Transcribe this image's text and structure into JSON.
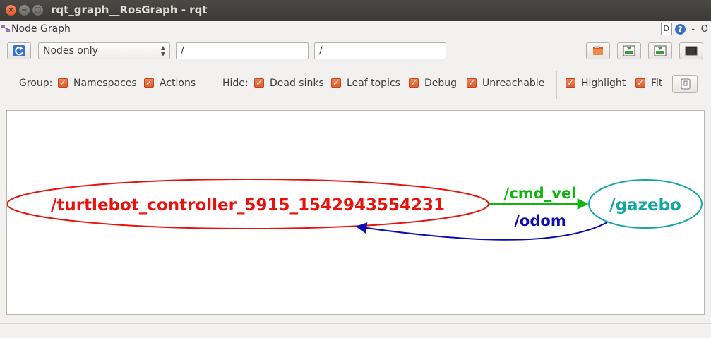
{
  "window": {
    "title": "rqt_graph__RosGraph - rqt"
  },
  "plugin": {
    "title": "Node Graph",
    "help_label": "D",
    "question": "?",
    "dash": "-",
    "circle": "O"
  },
  "toolbar": {
    "view_mode": "Nodes only",
    "filter_nodes": "/",
    "filter_topics": "/"
  },
  "options": {
    "group_label": "Group:",
    "namespaces": "Namespaces",
    "actions": "Actions",
    "hide_label": "Hide:",
    "dead_sinks": "Dead sinks",
    "leaf_topics": "Leaf topics",
    "debug": "Debug",
    "unreachable": "Unreachable",
    "highlight": "Highlight",
    "fit": "Fit",
    "checked": "✓"
  },
  "graph": {
    "nodes": [
      {
        "id": "controller",
        "label": "/turtlebot_controller_5915_1542943554231",
        "color": "#e8120c"
      },
      {
        "id": "gazebo",
        "label": "/gazebo",
        "color": "#14a6a2"
      }
    ],
    "edges": [
      {
        "label": "/cmd_vel",
        "color": "#10b510"
      },
      {
        "label": "/odom",
        "color": "#0c0cae"
      }
    ]
  },
  "colors": {
    "accent_check": "#e06a39",
    "refresh_blue": "#3a73c7"
  }
}
